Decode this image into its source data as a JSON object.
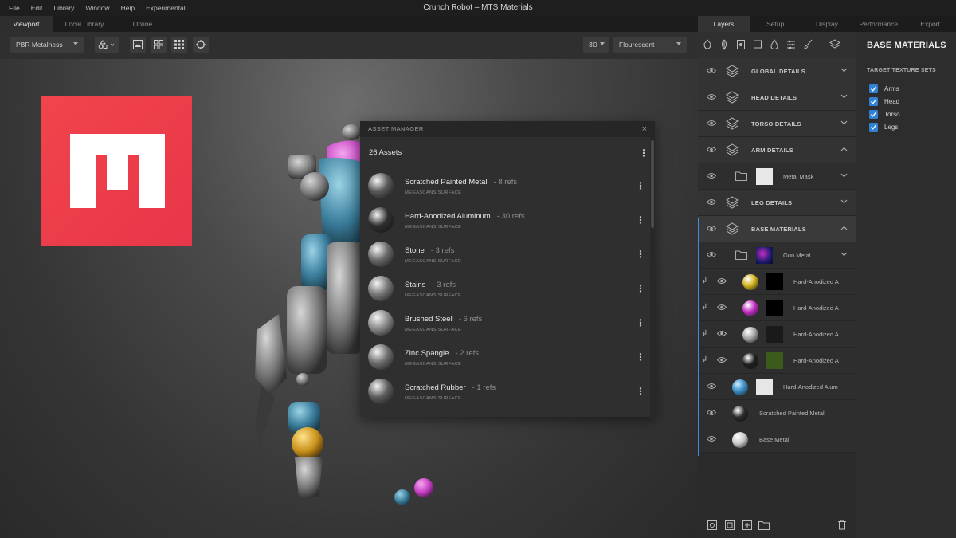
{
  "menu": {
    "items": [
      "File",
      "Edit",
      "Library",
      "Window",
      "Help",
      "Experimental"
    ],
    "title": "Crunch Robot – MTS Materials"
  },
  "viewport_tabs": [
    "Viewport",
    "Local Library",
    "Online"
  ],
  "toolbar": {
    "shader": "PBR Metalness",
    "view_mode": "3D",
    "lighting": "Flourescent"
  },
  "asset_manager": {
    "title": "ASSET MANAGER",
    "close": "×",
    "count": "26 Assets",
    "assets": [
      {
        "name": "Scratched Painted Metal",
        "refs": "- 8 refs",
        "source": "MEGASCANS SURFACE",
        "color": "#5a5a5a"
      },
      {
        "name": "Hard-Anodized Aluminum",
        "refs": "- 30 refs",
        "source": "MEGASCANS SURFACE",
        "color": "#2e2e2e"
      },
      {
        "name": "Stone",
        "refs": "- 3 refs",
        "source": "MEGASCANS SURFACE",
        "color": "#6a6a6a"
      },
      {
        "name": "Stains",
        "refs": "- 3 refs",
        "source": "MEGASCANS SURFACE",
        "color": "#777777"
      },
      {
        "name": "Brushed Steel",
        "refs": "- 6 refs",
        "source": "MEGASCANS SURFACE",
        "color": "#8a8a8a"
      },
      {
        "name": "Zinc Spangle",
        "refs": "- 2 refs",
        "source": "MEGASCANS SURFACE",
        "color": "#6e6e6e"
      },
      {
        "name": "Scratched Rubber",
        "refs": "- 1 refs",
        "source": "MEGASCANS SURFACE",
        "color": "#5c5c5c"
      }
    ]
  },
  "right_tabs": [
    "Layers",
    "Setup",
    "Display",
    "Performance",
    "Export"
  ],
  "layers": {
    "groups": [
      {
        "label": "GLOBAL DETAILS",
        "expanded": false
      },
      {
        "label": "HEAD DETAILS",
        "expanded": false
      },
      {
        "label": "TORSO DETAILS",
        "expanded": false
      },
      {
        "label": "ARM DETAILS",
        "expanded": true
      },
      {
        "label": "LEG DETAILS",
        "expanded": false
      },
      {
        "label": "BASE MATERIALS",
        "expanded": true
      }
    ],
    "arm_child": "Metal Mask",
    "base_children": [
      {
        "label": "Gun Metal"
      },
      {
        "label": "Hard-Anodized A",
        "ball": "#d4b21c"
      },
      {
        "label": "Hard-Anodized A",
        "ball": "#c42ec4"
      },
      {
        "label": "Hard-Anodized A",
        "ball": "#a6a6a6"
      },
      {
        "label": "Hard-Anodized A",
        "ball": "#1e1e1e"
      },
      {
        "label": "Hard-Anodized Alum",
        "ball": "#3d8fc4"
      },
      {
        "label": "Scratched Painted Metal",
        "ball": "#2a2a2a"
      },
      {
        "label": "Base Metal",
        "ball": "#c9c9c9"
      }
    ]
  },
  "base_materials": {
    "title": "BASE MATERIALS",
    "subtitle": "TARGET TEXTURE SETS",
    "texture_sets": [
      "Arms",
      "Head",
      "Torso",
      "Legs"
    ]
  },
  "colors": {
    "accent": "#2f82d6",
    "brand": "#ee3e4a"
  }
}
